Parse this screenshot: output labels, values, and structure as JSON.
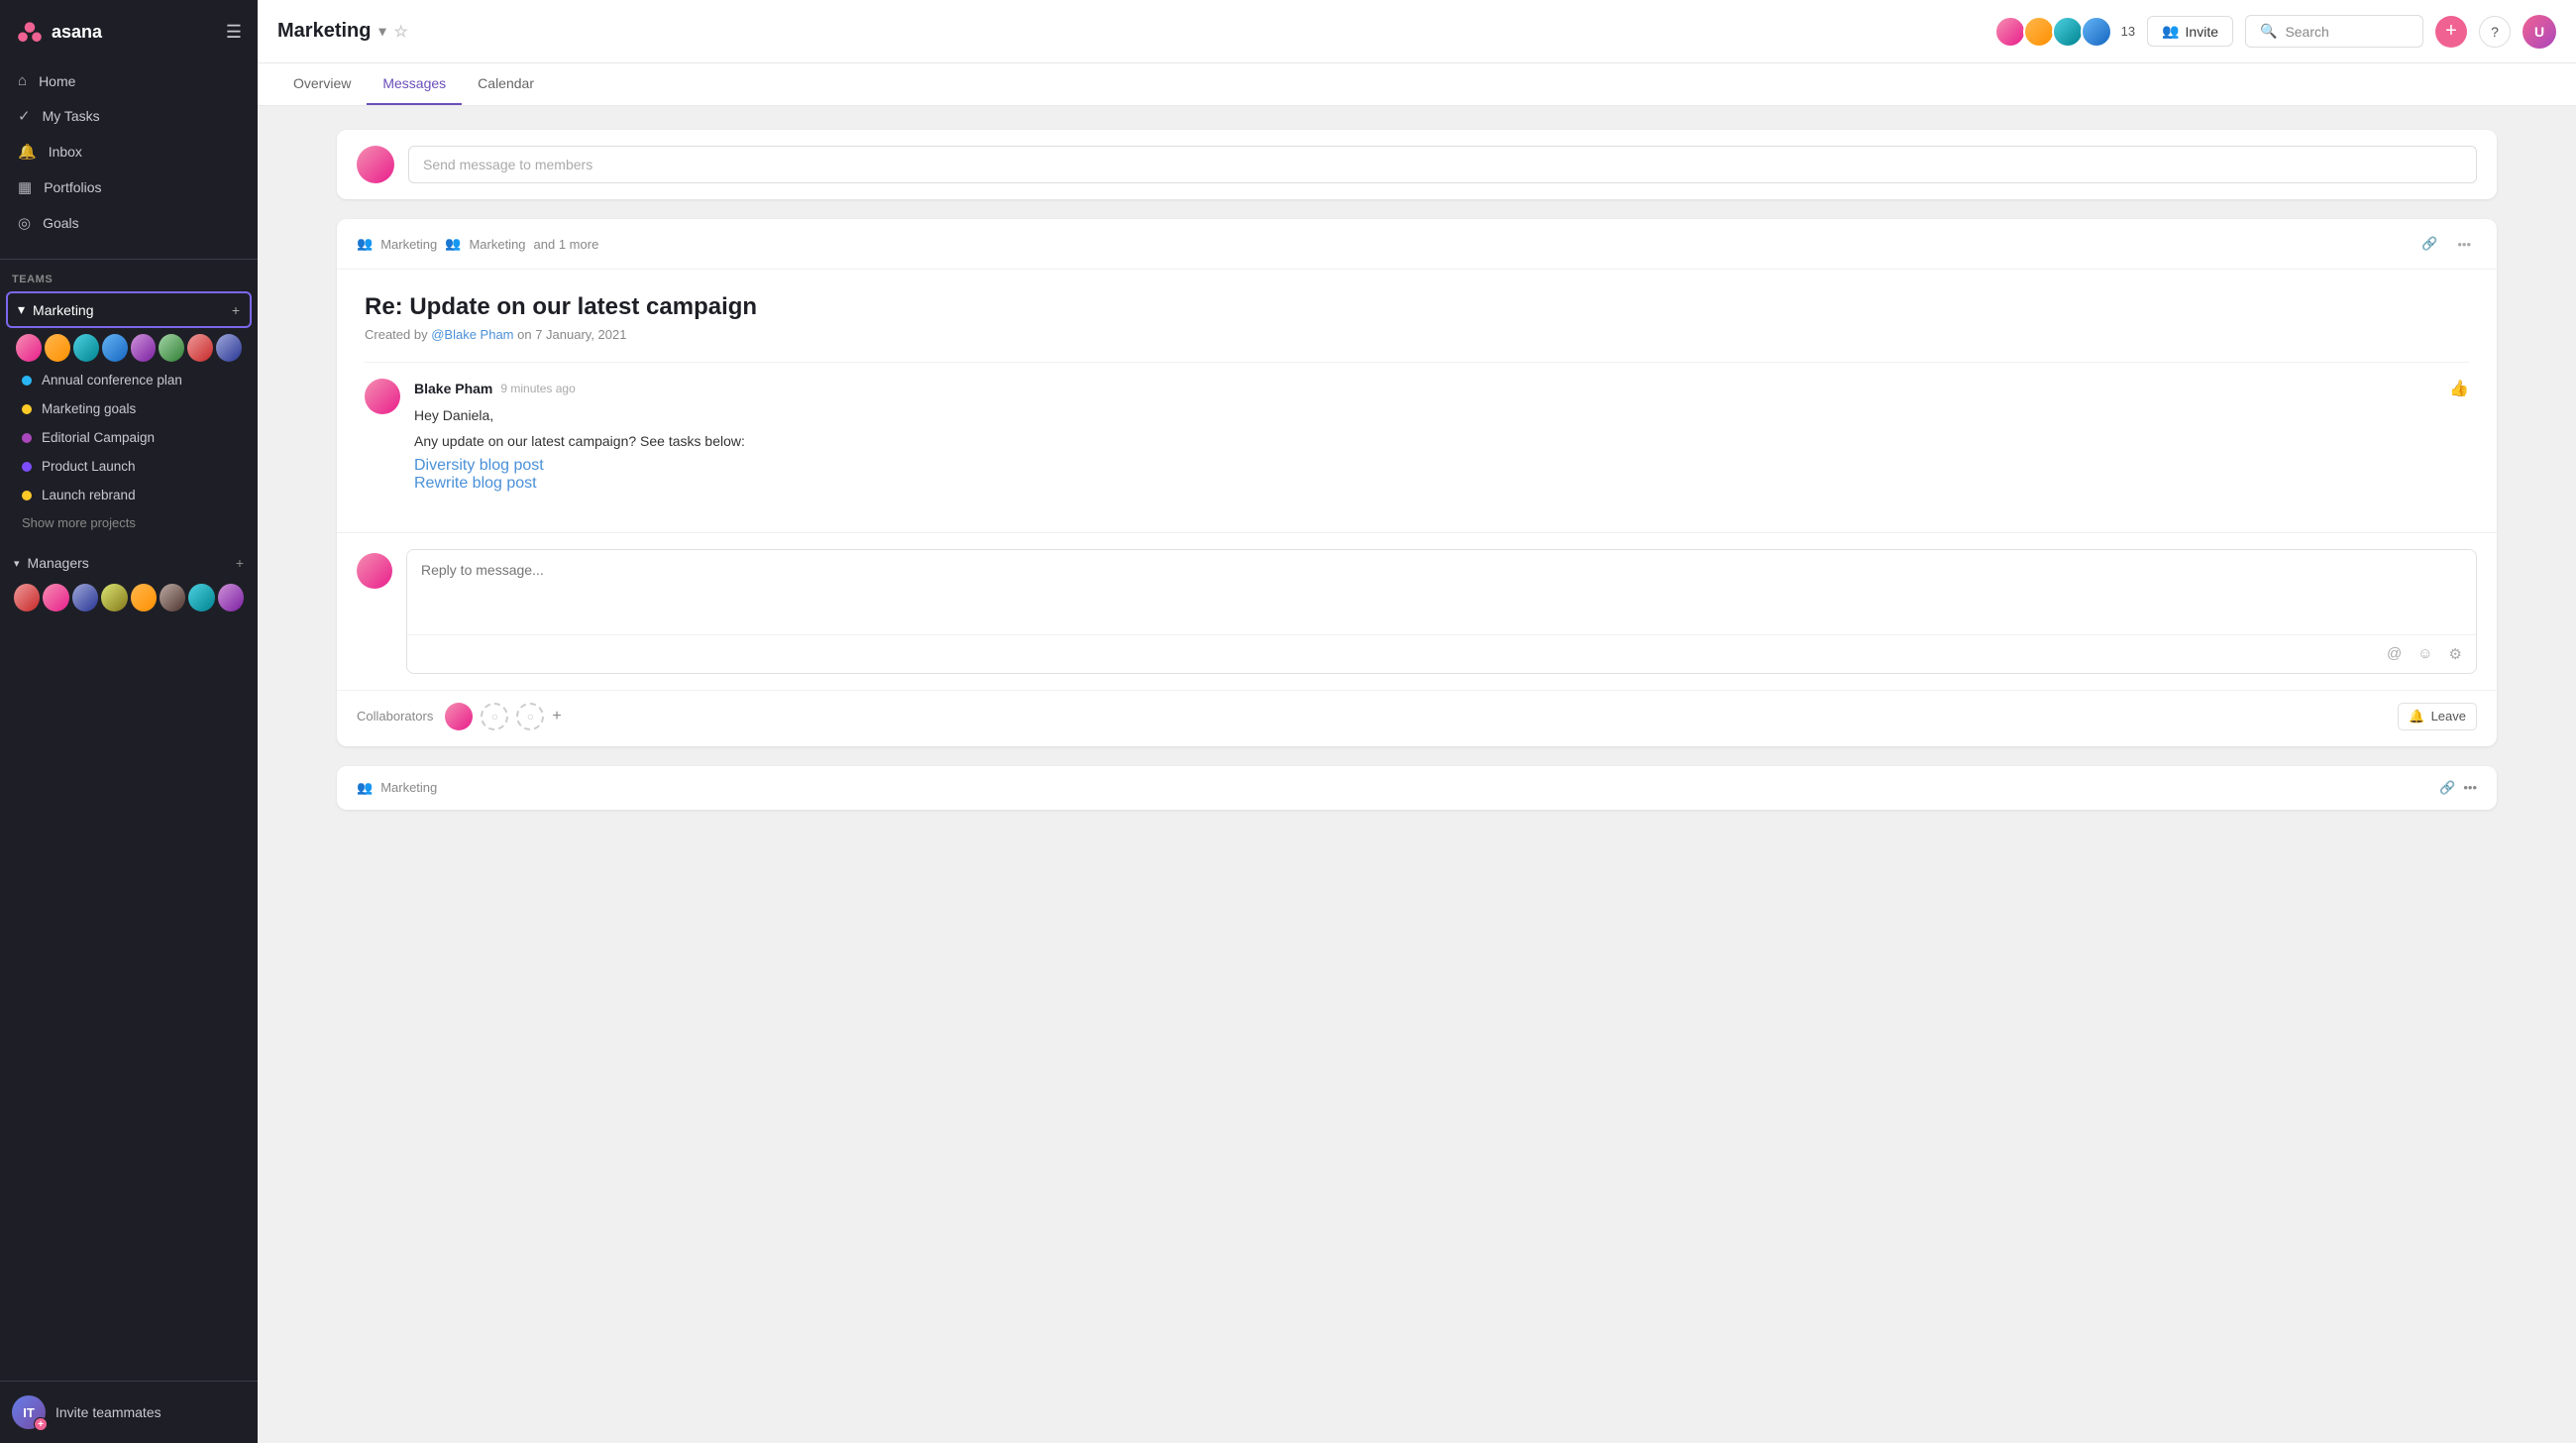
{
  "app": {
    "logo_text": "asana"
  },
  "sidebar": {
    "nav_items": [
      {
        "id": "home",
        "label": "Home",
        "icon": "⌂"
      },
      {
        "id": "my-tasks",
        "label": "My Tasks",
        "icon": "✓"
      },
      {
        "id": "inbox",
        "label": "Inbox",
        "icon": "🔔"
      },
      {
        "id": "portfolios",
        "label": "Portfolios",
        "icon": "📊"
      },
      {
        "id": "goals",
        "label": "Goals",
        "icon": "⊙"
      }
    ],
    "teams_label": "Teams",
    "marketing_team": {
      "name": "Marketing",
      "projects": [
        {
          "id": "annual-conf",
          "label": "Annual conference plan",
          "color": "#29b6f6"
        },
        {
          "id": "marketing-goals",
          "label": "Marketing goals",
          "color": "#ffca28"
        },
        {
          "id": "editorial-campaign",
          "label": "Editorial Campaign",
          "color": "#ab47bc"
        },
        {
          "id": "product-launch",
          "label": "Product Launch",
          "color": "#7c4dff"
        },
        {
          "id": "launch-rebrand",
          "label": "Launch rebrand",
          "color": "#ffca28"
        }
      ],
      "show_more": "Show more projects"
    },
    "managers_team": {
      "name": "Managers"
    },
    "invite": {
      "label": "Invite teammates"
    }
  },
  "topbar": {
    "title": "Marketing",
    "member_count": "13",
    "invite_label": "Invite",
    "search_placeholder": "Search",
    "tabs": [
      {
        "id": "overview",
        "label": "Overview"
      },
      {
        "id": "messages",
        "label": "Messages",
        "active": true
      },
      {
        "id": "calendar",
        "label": "Calendar"
      }
    ]
  },
  "compose": {
    "placeholder": "Send message to members"
  },
  "thread": {
    "recipients": "Marketing   Marketing   and 1 more",
    "recipient1": "Marketing",
    "recipient2": "Marketing",
    "recipient_extra": "and 1 more",
    "title": "Re: Update on our latest campaign",
    "created_by_prefix": "Created by",
    "created_by_mention": "@Blake Pham",
    "created_by_suffix": "on 7 January, 2021",
    "message": {
      "author": "Blake Pham",
      "time": "9 minutes ago",
      "greeting": "Hey Daniela,",
      "body": "Any update on our latest campaign? See tasks below:",
      "links": [
        {
          "id": "link1",
          "label": "Diversity blog post"
        },
        {
          "id": "link2",
          "label": "Rewrite blog post"
        }
      ]
    },
    "reply_placeholder": "Reply to message...",
    "collaborators_label": "Collaborators",
    "leave_label": "Leave"
  },
  "thread2": {
    "recipient": "Marketing"
  }
}
